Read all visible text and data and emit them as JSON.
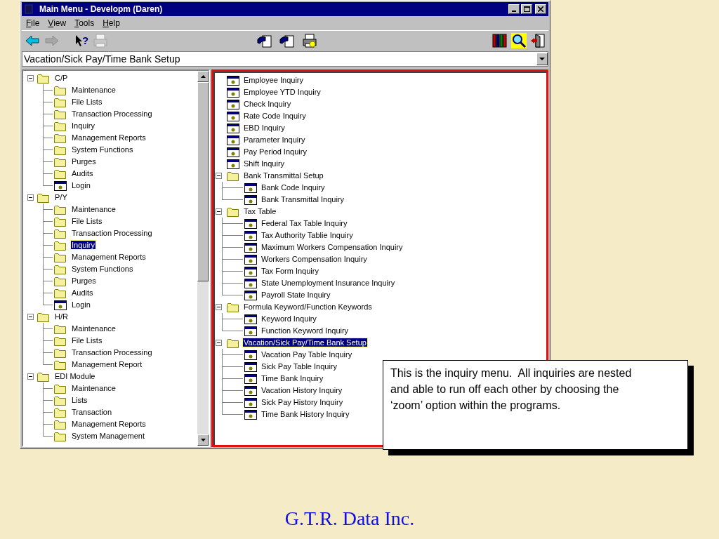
{
  "window": {
    "title": "Main Menu - Developm (Daren)"
  },
  "menu": [
    "File",
    "View",
    "Tools",
    "Help"
  ],
  "toolbar": {
    "left": [
      {
        "kind": "back",
        "disabled": false
      },
      {
        "kind": "forward",
        "disabled": true
      },
      {
        "kind": "help",
        "glyph": "?",
        "disabled": false
      },
      {
        "kind": "printer",
        "disabled": true
      }
    ],
    "center": [
      {
        "kind": "hand-card",
        "disabled": false
      },
      {
        "kind": "hand-card",
        "disabled": false
      },
      {
        "kind": "printer",
        "disabled": false
      }
    ],
    "right": [
      {
        "kind": "books",
        "disabled": false
      },
      {
        "kind": "search",
        "disabled": false
      },
      {
        "kind": "exit",
        "disabled": false
      }
    ]
  },
  "location": {
    "value": "Vacation/Sick Pay/Time Bank Setup"
  },
  "left_tree": [
    {
      "label": "C/P",
      "kind": "folder",
      "expanded": true,
      "selected": false,
      "children": [
        {
          "label": "Maintenance",
          "kind": "folder",
          "selected": false
        },
        {
          "label": "File Lists",
          "kind": "folder",
          "selected": false
        },
        {
          "label": "Transaction Processing",
          "kind": "folder",
          "selected": false
        },
        {
          "label": "Inquiry",
          "kind": "folder",
          "selected": false
        },
        {
          "label": "Management Reports",
          "kind": "folder",
          "selected": false
        },
        {
          "label": "System Functions",
          "kind": "folder",
          "selected": false
        },
        {
          "label": "Purges",
          "kind": "folder",
          "selected": false
        },
        {
          "label": "Audits",
          "kind": "folder",
          "selected": false
        },
        {
          "label": "Login",
          "kind": "program",
          "selected": false
        }
      ]
    },
    {
      "label": "P/Y",
      "kind": "folder",
      "expanded": true,
      "selected": false,
      "children": [
        {
          "label": "Maintenance",
          "kind": "folder",
          "selected": false
        },
        {
          "label": "File Lists",
          "kind": "folder",
          "selected": false
        },
        {
          "label": "Transaction Processing",
          "kind": "folder",
          "selected": false
        },
        {
          "label": "Inquiry",
          "kind": "folder",
          "selected": true
        },
        {
          "label": "Management Reports",
          "kind": "folder",
          "selected": false
        },
        {
          "label": "System Functions",
          "kind": "folder",
          "selected": false
        },
        {
          "label": "Purges",
          "kind": "folder",
          "selected": false
        },
        {
          "label": "Audits",
          "kind": "folder",
          "selected": false
        },
        {
          "label": "Login",
          "kind": "program",
          "selected": false
        }
      ]
    },
    {
      "label": "H/R",
      "kind": "folder",
      "expanded": true,
      "selected": false,
      "children": [
        {
          "label": "Maintenance",
          "kind": "folder",
          "selected": false
        },
        {
          "label": "File Lists",
          "kind": "folder",
          "selected": false
        },
        {
          "label": "Transaction Processing",
          "kind": "folder",
          "selected": false
        },
        {
          "label": "Management Report",
          "kind": "folder",
          "selected": false
        }
      ]
    },
    {
      "label": "EDI Module",
      "kind": "folder",
      "expanded": true,
      "selected": false,
      "children": [
        {
          "label": "Maintenance",
          "kind": "folder",
          "selected": false
        },
        {
          "label": "Lists",
          "kind": "folder",
          "selected": false
        },
        {
          "label": "Transaction",
          "kind": "folder",
          "selected": false
        },
        {
          "label": "Management Reports",
          "kind": "folder",
          "selected": false
        },
        {
          "label": "System Management",
          "kind": "folder",
          "selected": false
        }
      ]
    }
  ],
  "right_list": [
    {
      "label": "Employee Inquiry",
      "kind": "program",
      "selected": false
    },
    {
      "label": "Employee YTD Inquiry",
      "kind": "program",
      "selected": false
    },
    {
      "label": "Check Inquiry",
      "kind": "program",
      "selected": false
    },
    {
      "label": "Rate Code Inquiry",
      "kind": "program",
      "selected": false
    },
    {
      "label": "EBD Inquiry",
      "kind": "program",
      "selected": false
    },
    {
      "label": "Parameter Inquiry",
      "kind": "program",
      "selected": false
    },
    {
      "label": "Pay Period Inquiry",
      "kind": "program",
      "selected": false
    },
    {
      "label": "Shift Inquiry",
      "kind": "program",
      "selected": false
    },
    {
      "label": "Bank Transmittal Setup",
      "kind": "folder",
      "expanded": true,
      "selected": false,
      "children": [
        {
          "label": "Bank Code Inquiry",
          "kind": "program",
          "selected": false
        },
        {
          "label": "Bank Transmittal Inquiry",
          "kind": "program",
          "selected": false
        }
      ]
    },
    {
      "label": "Tax Table",
      "kind": "folder",
      "expanded": true,
      "selected": false,
      "children": [
        {
          "label": "Federal Tax Table Inquiry",
          "kind": "program",
          "selected": false
        },
        {
          "label": "Tax Authority Tablie Inquiry",
          "kind": "program",
          "selected": false
        },
        {
          "label": "Maximum Workers Compensation Inquiry",
          "kind": "program",
          "selected": false
        },
        {
          "label": "Workers Compensation Inquiry",
          "kind": "program",
          "selected": false
        },
        {
          "label": "Tax Form Inquiry",
          "kind": "program",
          "selected": false
        },
        {
          "label": "State Unemployment Insurance Inquiry",
          "kind": "program",
          "selected": false
        },
        {
          "label": "Payroll State Inquiry",
          "kind": "program",
          "selected": false
        }
      ]
    },
    {
      "label": "Formula Keyword/Function Keywords",
      "kind": "folder",
      "expanded": true,
      "selected": false,
      "children": [
        {
          "label": "Keyword Inquiry",
          "kind": "program",
          "selected": false
        },
        {
          "label": "Function Keyword Inquiry",
          "kind": "program",
          "selected": false
        }
      ]
    },
    {
      "label": "Vacation/Sick Pay/Time Bank Setup",
      "kind": "folder",
      "expanded": true,
      "selected": true,
      "children": [
        {
          "label": "Vacation Pay Table Inquiry",
          "kind": "program",
          "selected": false
        },
        {
          "label": "Sick Pay Table Inquiry",
          "kind": "program",
          "selected": false
        },
        {
          "label": "Time Bank Inquiry",
          "kind": "program",
          "selected": false
        },
        {
          "label": "Vacation History Inquiry",
          "kind": "program",
          "selected": false
        },
        {
          "label": "Sick Pay History Inquiry",
          "kind": "program",
          "selected": false
        },
        {
          "label": "Time Bank History Inquiry",
          "kind": "program",
          "selected": false
        }
      ]
    }
  ],
  "callout": {
    "text": "This is the inquiry menu.  All inquiries are nested and able to run off each other by choosing the ‘zoom’ option within the programs."
  },
  "footer": {
    "text": "G.T.R. Data Inc."
  }
}
